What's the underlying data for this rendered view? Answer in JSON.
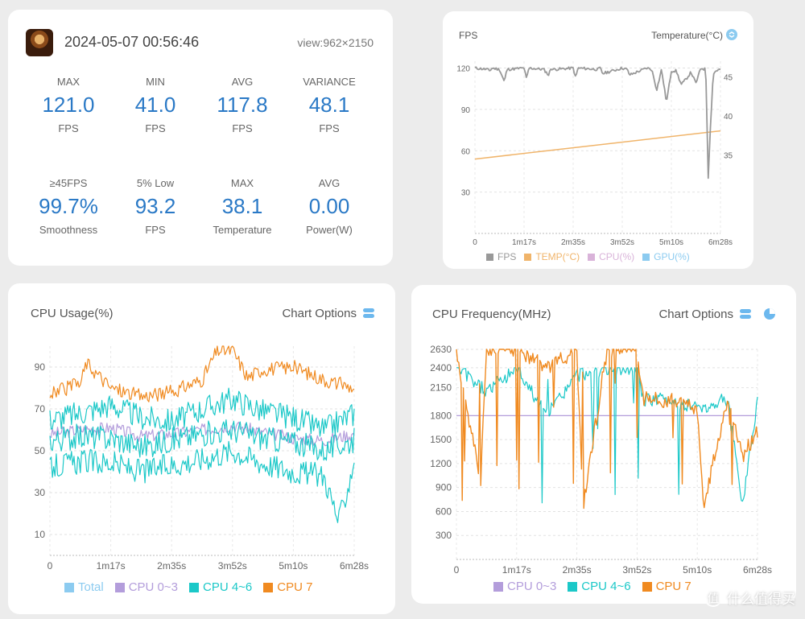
{
  "summary": {
    "datetime": "2024-05-07 00:56:46",
    "view": "view:962×2150",
    "stats": [
      {
        "label": "MAX",
        "value": "121.0",
        "unit": "FPS"
      },
      {
        "label": "MIN",
        "value": "41.0",
        "unit": "FPS"
      },
      {
        "label": "AVG",
        "value": "117.8",
        "unit": "FPS"
      },
      {
        "label": "VARIANCE",
        "value": "48.1",
        "unit": "FPS"
      },
      {
        "label": "≥45FPS",
        "value": "99.7%",
        "unit": "Smoothness"
      },
      {
        "label": "5% Low",
        "value": "93.2",
        "unit": "FPS"
      },
      {
        "label": "MAX",
        "value": "38.1",
        "unit": "Temperature"
      },
      {
        "label": "AVG",
        "value": "0.00",
        "unit": "Power(W)"
      }
    ]
  },
  "fps_card": {
    "title": "FPS",
    "right_title": "Temperature(°C)",
    "icon": "refresh-icon"
  },
  "cpu_card": {
    "title": "CPU Usage(%)",
    "options": "Chart Options",
    "icon": "toggle-icon"
  },
  "freq_card": {
    "title": "CPU Frequency(MHz)",
    "options": "Chart Options",
    "icon": "toggle-icon",
    "icon2": "pie-icon"
  },
  "watermark": {
    "icon": "值",
    "text": "什么值得买"
  },
  "colors": {
    "accent": "#2a79c6",
    "fps": "#999999",
    "temp": "#f0b46a",
    "cpu": "#d9b3d9",
    "gpu": "#8ccbf0",
    "total": "#8ccbf0",
    "cpu03": "#b39ddb",
    "cpu46": "#1bc8c8",
    "cpu7": "#f08a20"
  },
  "chart_data": [
    {
      "type": "line",
      "title": "FPS",
      "x_ticks": [
        "0",
        "1m17s",
        "2m35s",
        "3m52s",
        "5m10s",
        "6m28s"
      ],
      "y_ticks": [
        120,
        90,
        60,
        30
      ],
      "y2_ticks": [
        45,
        40,
        35
      ],
      "ylim": [
        0,
        125
      ],
      "y2lim": [
        25,
        47
      ],
      "legend": [
        "FPS",
        "TEMP(°C)",
        "CPU(%)",
        "GPU(%)"
      ],
      "series": [
        {
          "name": "FPS",
          "x": [
            0,
            0.05,
            0.06,
            0.07,
            0.1,
            0.12,
            0.13,
            0.2,
            0.21,
            0.22,
            0.28,
            0.3,
            0.31,
            0.32,
            0.4,
            0.41,
            0.42,
            0.5,
            0.51,
            0.52,
            0.6,
            0.62,
            0.63,
            0.7,
            0.72,
            0.73,
            0.74,
            0.76,
            0.78,
            0.8,
            0.82,
            0.84,
            0.86,
            0.88,
            0.9,
            0.92,
            0.94,
            0.95,
            0.96,
            0.97,
            0.98,
            1.0
          ],
          "y": [
            120,
            119,
            118,
            120,
            119,
            110,
            119,
            120,
            112,
            120,
            119,
            115,
            120,
            119,
            120,
            113,
            120,
            119,
            120,
            116,
            120,
            119,
            115,
            120,
            119,
            112,
            104,
            119,
            95,
            118,
            118,
            108,
            112,
            117,
            109,
            120,
            119,
            41,
            80,
            115,
            118,
            119
          ]
        },
        {
          "name": "TEMP(°C)",
          "x": [
            0,
            1.0
          ],
          "y": [
            34.5,
            38.1
          ]
        }
      ]
    },
    {
      "type": "line",
      "title": "CPU Usage(%)",
      "x_ticks": [
        "0",
        "1m17s",
        "2m35s",
        "3m52s",
        "5m10s",
        "6m28s"
      ],
      "y_ticks": [
        90,
        70,
        50,
        30,
        10
      ],
      "ylim": [
        0,
        100
      ],
      "legend": [
        "Total",
        "CPU 0~3",
        "CPU 4~6",
        "CPU 7"
      ],
      "series": [
        {
          "name": "CPU 0~3",
          "x": [
            0,
            0.1,
            0.2,
            0.3,
            0.4,
            0.5,
            0.6,
            0.7,
            0.8,
            0.9,
            1.0
          ],
          "y": [
            58,
            60,
            61,
            57,
            58,
            60,
            62,
            59,
            56,
            55,
            58
          ]
        },
        {
          "name": "CPU 4~6 (high)",
          "x": [
            0,
            0.1,
            0.2,
            0.3,
            0.4,
            0.5,
            0.6,
            0.7,
            0.8,
            0.9,
            1.0
          ],
          "y": [
            65,
            68,
            72,
            66,
            64,
            70,
            75,
            69,
            66,
            60,
            68
          ]
        },
        {
          "name": "CPU 4~6 (mid)",
          "x": [
            0,
            0.1,
            0.2,
            0.3,
            0.4,
            0.5,
            0.6,
            0.7,
            0.8,
            0.9,
            1.0
          ],
          "y": [
            55,
            57,
            56,
            52,
            55,
            58,
            60,
            56,
            54,
            50,
            55
          ]
        },
        {
          "name": "CPU 4~6 (low)",
          "x": [
            0,
            0.1,
            0.2,
            0.3,
            0.4,
            0.5,
            0.6,
            0.7,
            0.8,
            0.9,
            0.95,
            1.0
          ],
          "y": [
            42,
            45,
            44,
            40,
            43,
            46,
            50,
            44,
            40,
            38,
            16,
            45
          ]
        },
        {
          "name": "CPU 7",
          "x": [
            0,
            0.1,
            0.12,
            0.2,
            0.3,
            0.4,
            0.5,
            0.55,
            0.6,
            0.65,
            0.7,
            0.8,
            0.9,
            1.0
          ],
          "y": [
            77,
            82,
            92,
            80,
            76,
            78,
            84,
            98,
            98,
            85,
            89,
            90,
            84,
            80
          ]
        }
      ]
    },
    {
      "type": "line",
      "title": "CPU Frequency(MHz)",
      "x_ticks": [
        "0",
        "1m17s",
        "2m35s",
        "3m52s",
        "5m10s",
        "6m28s"
      ],
      "y_ticks": [
        2630,
        2400,
        2150,
        1800,
        1500,
        1200,
        900,
        600,
        300
      ],
      "ylim": [
        0,
        2630
      ],
      "legend": [
        "CPU 0~3",
        "CPU 4~6",
        "CPU 7"
      ],
      "series": [
        {
          "name": "CPU 0~3",
          "x": [
            0,
            1.0
          ],
          "y": [
            1800,
            1800
          ]
        },
        {
          "name": "CPU 4~6",
          "x": [
            0,
            0.1,
            0.2,
            0.3,
            0.4,
            0.5,
            0.6,
            0.62,
            0.7,
            0.8,
            0.9,
            0.95,
            1.0
          ],
          "y": [
            2400,
            2100,
            2400,
            1800,
            2300,
            2400,
            2400,
            2000,
            2000,
            1900,
            2000,
            700,
            2000
          ]
        },
        {
          "name": "CPU 7",
          "x": [
            0,
            0.08,
            0.1,
            0.2,
            0.3,
            0.4,
            0.42,
            0.5,
            0.6,
            0.62,
            0.7,
            0.8,
            0.82,
            0.9,
            0.95,
            1.0
          ],
          "y": [
            2630,
            950,
            2630,
            2630,
            2400,
            2630,
            650,
            2630,
            2630,
            2000,
            2000,
            1900,
            650,
            2000,
            1300,
            1600
          ]
        }
      ]
    }
  ]
}
